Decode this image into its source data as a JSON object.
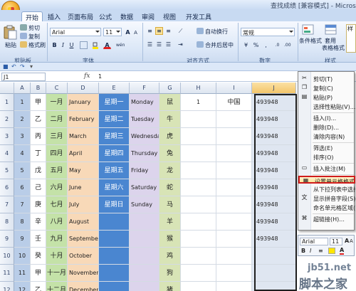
{
  "window": {
    "title": "查找成绩 [兼容模式] - Microso"
  },
  "tabs": [
    "开始",
    "插入",
    "页面布局",
    "公式",
    "数据",
    "审阅",
    "视图",
    "开发工具"
  ],
  "ribbon": {
    "clipboard": {
      "paste": "粘贴",
      "cut": "剪切",
      "copy": "复制",
      "format_painter": "格式刷",
      "label": "剪贴板"
    },
    "font": {
      "name": "Arial",
      "size": "11",
      "label": "字体",
      "bold": "B",
      "italic": "I",
      "underline": "U",
      "grow": "A",
      "shrink": "A",
      "font_color_letter": "A",
      "phonetic": "wén"
    },
    "alignment": {
      "wrap": "自动换行",
      "merge": "合并后居中",
      "label": "对齐方式"
    },
    "number": {
      "format": "常规",
      "label": "数字"
    },
    "styles": {
      "conditional": "条件格式",
      "table": "套用\n表格格式",
      "preview": "样",
      "label": "样式"
    }
  },
  "formula_bar": {
    "name_box": "J1",
    "fx": "fx",
    "content": "1"
  },
  "columns": [
    "A",
    "B",
    "C",
    "D",
    "E",
    "F",
    "G",
    "H",
    "I",
    "J"
  ],
  "rows": [
    "1",
    "2",
    "3",
    "4",
    "5",
    "6",
    "7",
    "8",
    "9",
    "10",
    "11",
    "12"
  ],
  "cells": {
    "A": [
      "1",
      "2",
      "3",
      "4",
      "5",
      "6",
      "7",
      "8",
      "9",
      "10",
      "11",
      "12"
    ],
    "B": [
      "甲",
      "乙",
      "丙",
      "丁",
      "戊",
      "己",
      "庚",
      "辛",
      "壬",
      "癸",
      "甲",
      "乙"
    ],
    "C": [
      "一月",
      "二月",
      "三月",
      "四月",
      "五月",
      "六月",
      "七月",
      "八月",
      "九月",
      "十月",
      "十一月",
      "十二月"
    ],
    "D": [
      "January",
      "February",
      "March",
      "April",
      "May",
      "June",
      "July",
      "August",
      "September",
      "October",
      "November",
      "December"
    ],
    "E": [
      "星期一",
      "星期二",
      "星期三",
      "星期四",
      "星期五",
      "星期六",
      "星期日",
      "",
      "",
      "",
      "",
      ""
    ],
    "F": [
      "Monday",
      "Tuesday",
      "Wednesday",
      "Thursday",
      "Friday",
      "Saturday",
      "Sunday",
      "",
      "",
      "",
      "",
      ""
    ],
    "G": [
      "鼠",
      "牛",
      "虎",
      "兔",
      "龙",
      "蛇",
      "马",
      "羊",
      "猴",
      "鸡",
      "狗",
      "猪"
    ],
    "H": [
      "1",
      "",
      "",
      "",
      "",
      "",
      "",
      "",
      "",
      "",
      "",
      ""
    ],
    "I": [
      "中国",
      "",
      "",
      "",
      "",
      "",
      "",
      "",
      "",
      "",
      "",
      ""
    ],
    "J": [
      "493948",
      "493948",
      "493948",
      "493948",
      "493948",
      "493948",
      "493948",
      "493948",
      "493948",
      "",
      "",
      ""
    ]
  },
  "column_colors": {
    "A": "#b9cde8",
    "B": "#ffffff",
    "C": "#c4e2a8",
    "D": "#f8d9b8",
    "E": "#4a86d0",
    "F": "#dcd4ec",
    "G": "#d8e4b6",
    "H": "#ffffff",
    "I": "#ffffff",
    "J": "#dfe6f1"
  },
  "context_menu": {
    "items": [
      {
        "label": "剪切(T)",
        "icon": "scissors-icon"
      },
      {
        "label": "复制(C)",
        "icon": "copy-icon"
      },
      {
        "label": "粘贴(P)",
        "icon": "paste-icon"
      },
      {
        "label": "选择性粘贴(V)...",
        "icon": ""
      },
      {
        "label": "插入(I)...",
        "icon": ""
      },
      {
        "label": "删除(D)...",
        "icon": ""
      },
      {
        "label": "清除内容(N)",
        "icon": ""
      },
      {
        "label": "筛选(E)",
        "icon": ""
      },
      {
        "label": "排序(O)",
        "icon": ""
      },
      {
        "label": "插入批注(M)",
        "icon": "comment-icon"
      },
      {
        "label": "设置单元格格式(F)...",
        "icon": "format-cells-icon"
      },
      {
        "label": "从下拉列表中选择(K)...",
        "icon": ""
      },
      {
        "label": "显示拼音字段(S)",
        "icon": "phonetic-icon"
      },
      {
        "label": "命名单元格区域(R)...",
        "icon": ""
      },
      {
        "label": "超链接(H)...",
        "icon": "hyperlink-icon"
      }
    ],
    "highlighted_index": 10
  },
  "mini_toolbar": {
    "font": "Arial",
    "size": "11",
    "grow": "A",
    "shrink": "A"
  },
  "watermark": {
    "line1": "jb51.net",
    "line2": "脚本之家"
  }
}
